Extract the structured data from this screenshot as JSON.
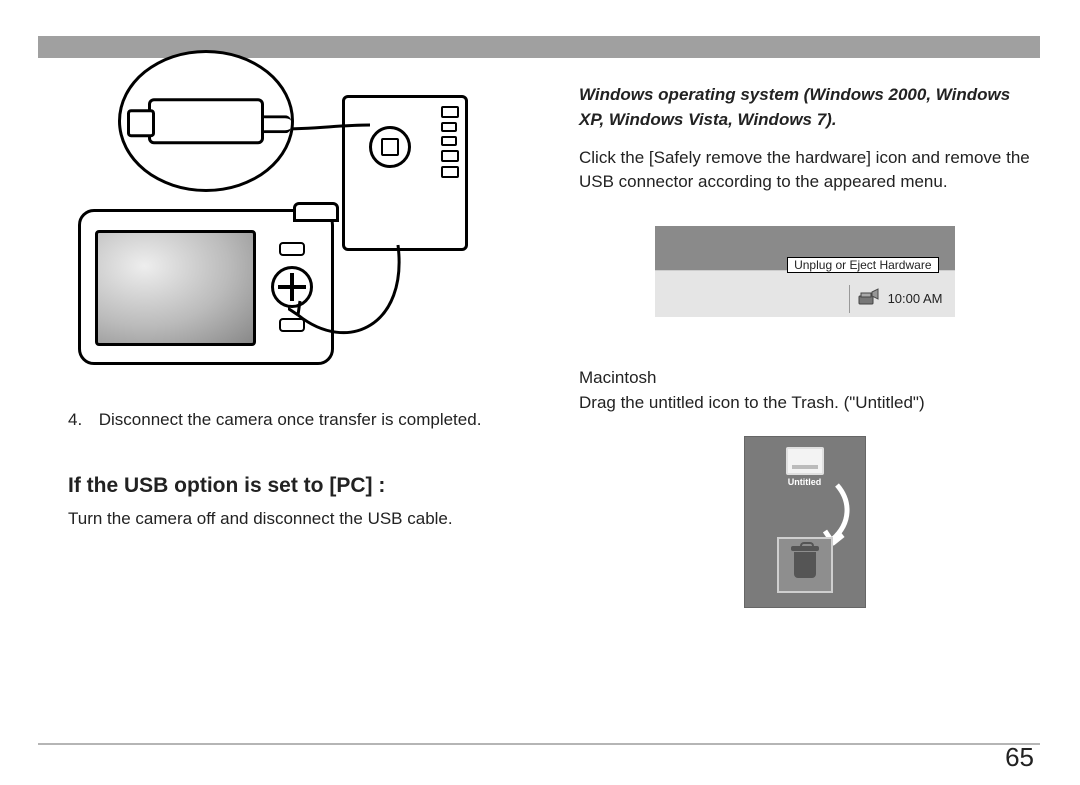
{
  "page_number": "65",
  "left": {
    "step_number": "4.",
    "step_text": "Disconnect the camera once transfer is completed.",
    "sub_heading": "If the USB option is set to [PC] :",
    "sub_text": "Turn the camera off and disconnect the USB cable."
  },
  "right": {
    "windows_note": "Windows operating system (Windows 2000, Windows XP, Windows Vista, Windows 7).",
    "windows_instruction": "Click the [Safely remove the hardware] icon and remove the USB connector according to the appeared menu.",
    "tooltip": "Unplug or Eject Hardware",
    "clock": "10:00 AM",
    "mac_heading": "Macintosh",
    "mac_instruction": "Drag the untitled icon to the Trash. (\"Untitled\")",
    "mac_drive_label": "Untitled"
  }
}
